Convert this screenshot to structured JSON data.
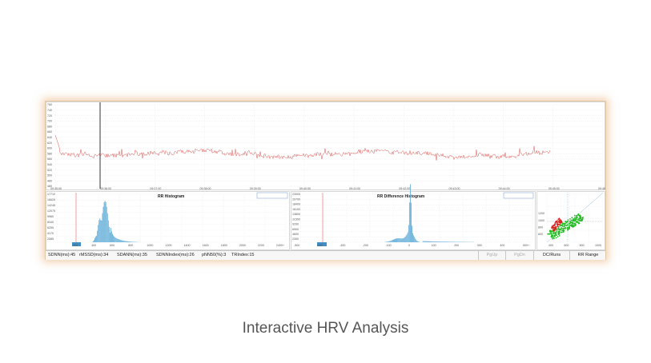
{
  "rr_tachogram": {
    "y_ticks": [
      "760",
      "740",
      "720",
      "700",
      "680",
      "660",
      "640",
      "620",
      "600",
      "580",
      "560",
      "540",
      "520",
      "500",
      "480",
      "460"
    ],
    "x_ticks": [
      "09:35:00",
      "09:36:00",
      "09:37:00",
      "09:38:00",
      "09:39:00",
      "09:40:00",
      "09:41:00",
      "09:42:00",
      "09:43:00",
      "09:44:00",
      "09:45:00",
      "09:46:00"
    ],
    "line_color": "#d9534f",
    "cursor_color": "#000000"
  },
  "rr_histogram": {
    "title": "RR Histogram",
    "x_ticks": [
      "200",
      "400",
      "600",
      "800",
      "1000",
      "1200",
      "1400",
      "1600",
      "1800",
      "2000",
      "2200",
      "2400+"
    ],
    "y_ticks": [
      "17710",
      "16625",
      "14245",
      "12075",
      "9960",
      "8340",
      "6255",
      "4170",
      "2085"
    ],
    "selection_label": "",
    "bar_color": "#5aa9d6"
  },
  "rr_diff_histogram": {
    "title": "RR Difference Histogram",
    "x_ticks": [
      "-500",
      "-400",
      "-300",
      "-200",
      "-100",
      "0",
      "100",
      "200",
      "300",
      "400",
      "500+"
    ],
    "y_ticks": [
      "23000",
      "20700",
      "18400",
      "16100",
      "13800",
      "11500",
      "9200",
      "6900",
      "4600",
      "2300"
    ],
    "bar_color": "#5aa9d6"
  },
  "poincare": {
    "x_ticks": [
      "400",
      "600",
      "800",
      "1000"
    ],
    "y_ticks": [
      "1200",
      "1000",
      "800",
      "600"
    ],
    "colors": [
      "#22bb22",
      "#dd2222"
    ]
  },
  "statusbar": {
    "sdnn": "SDNN(ms):45",
    "rmssd": "rMSSD(ms):34",
    "sdann": "SDANN(ms):35",
    "sdnn_index": "SDNNIndex(ms):26",
    "pnn50": "pNN50(%):3",
    "tri_index": "TRIndex:15",
    "btn_pgup": "PgUp",
    "btn_pgdn": "PgDn",
    "btn_dc_runs": "DC/Runs",
    "btn_rr_range": "RR Range"
  },
  "caption": "Interactive HRV Analysis"
}
